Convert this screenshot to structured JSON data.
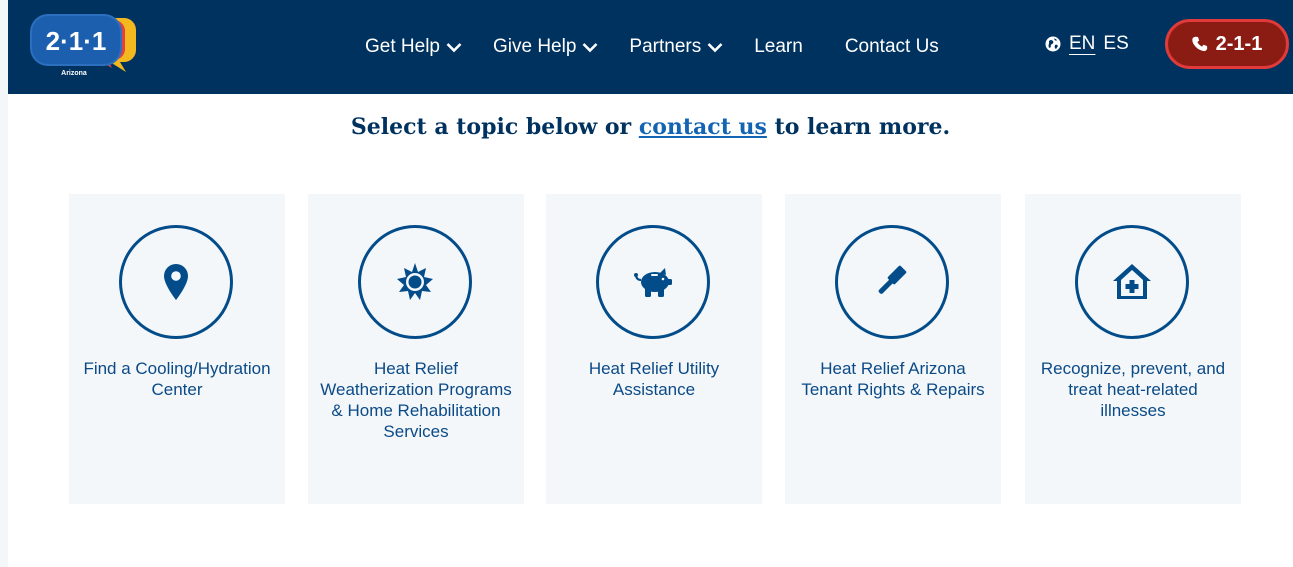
{
  "brand": {
    "logo_number": "2·1·1",
    "logo_region": "Arizona"
  },
  "nav": {
    "items": [
      {
        "label": "Get Help",
        "dropdown": true
      },
      {
        "label": "Give Help",
        "dropdown": true
      },
      {
        "label": "Partners",
        "dropdown": true
      },
      {
        "label": "Learn",
        "dropdown": false
      },
      {
        "label": "Contact Us",
        "dropdown": false
      }
    ],
    "lang": {
      "en": "EN",
      "es": "ES",
      "icon": "globe-icon"
    },
    "call_button": {
      "label": "2-1-1",
      "icon": "phone-icon"
    }
  },
  "headline": {
    "prefix": "Select a topic below or ",
    "link": "contact us",
    "suffix": " to learn more."
  },
  "topics": [
    {
      "label": "Find a Cooling/Hydration Center",
      "icon": "map-pin-icon"
    },
    {
      "label": "Heat Relief Weatherization Programs & Home Rehabilitation Services",
      "icon": "sun-icon"
    },
    {
      "label": "Heat Relief Utility Assistance",
      "icon": "piggy-bank-icon"
    },
    {
      "label": "Heat Relief Arizona Tenant Rights & Repairs",
      "icon": "gavel-icon"
    },
    {
      "label": "Recognize, prevent, and treat heat-related illnesses",
      "icon": "house-medical-icon"
    }
  ],
  "colors": {
    "navbar": "#00325f",
    "call_button": "#8b1c14",
    "call_button_border": "#e03a3a",
    "accent_blue": "#034c8a",
    "card_bg": "#f3f7fa"
  }
}
